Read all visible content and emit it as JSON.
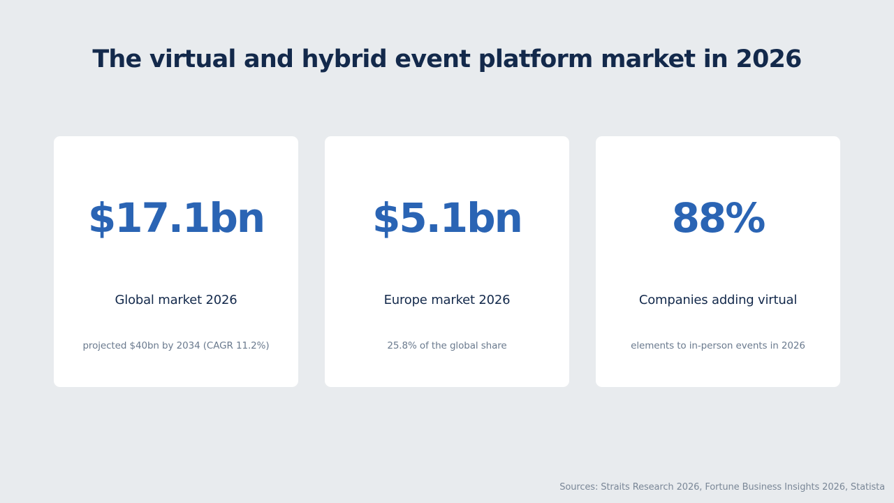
{
  "title": "The virtual and hybrid event platform market in 2026",
  "cards": [
    {
      "value": "$17.1bn",
      "label": "Global market 2026",
      "note": "projected $40bn by 2034 (CAGR 11.2%)"
    },
    {
      "value": "$5.1bn",
      "label": "Europe market 2026",
      "note": "25.8% of the global share"
    },
    {
      "value": "88%",
      "label": "Companies adding virtual",
      "note": "elements to in-person events in 2026"
    }
  ],
  "sources": "Sources: Straits Research 2026, Fortune Business Insights 2026, Statista",
  "colors": {
    "background": "#E8EBEE",
    "card": "#FFFFFF",
    "title": "#13294B",
    "accent": "#2A64B4",
    "muted": "#6A7A8E"
  }
}
